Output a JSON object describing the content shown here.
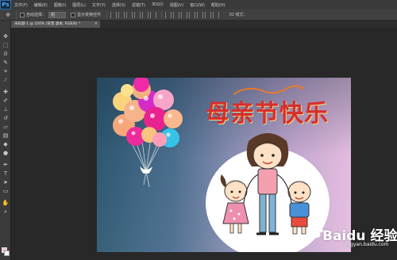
{
  "app": {
    "logo": "Ps",
    "menu": [
      "文件(F)",
      "编辑(E)",
      "图像(I)",
      "图层(L)",
      "文字(Y)",
      "选择(S)",
      "滤镜(T)",
      "3D(D)",
      "视图(V)",
      "窗口(W)",
      "帮助(H)"
    ]
  },
  "options": {
    "auto_select_label": "自动选择：",
    "auto_select_value": "组",
    "show_transform_label": "显示变换控件",
    "mode_3d_label": "3D 模式："
  },
  "document": {
    "tab_label": "未标题-1 @ 100% (背景 副本, RGB/8) *",
    "tab_close": "×"
  },
  "artwork": {
    "title": "母亲节快乐",
    "watermark_main": "Baidu 经验",
    "watermark_url": "jingyan.baidu.com"
  },
  "colors": {
    "foreground": "#f3c4d8",
    "background": "#ffffff",
    "title": "#d62e2e"
  },
  "tools": [
    "move-icon",
    "marquee-icon",
    "lasso-icon",
    "quick-select-icon",
    "crop-icon",
    "eyedropper-icon",
    "healing-icon",
    "brush-icon",
    "clone-stamp-icon",
    "history-brush-icon",
    "eraser-icon",
    "gradient-icon",
    "blur-icon",
    "dodge-icon",
    "pen-icon",
    "type-icon",
    "path-select-icon",
    "shape-icon",
    "hand-icon",
    "zoom-icon"
  ]
}
